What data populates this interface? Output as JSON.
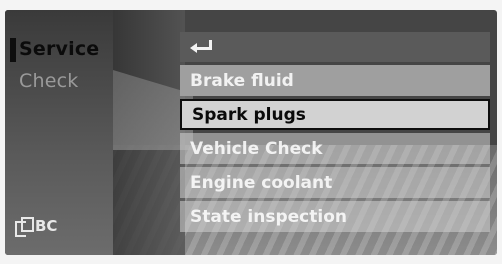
{
  "sidebar": {
    "items": [
      {
        "label": "Service",
        "selected": true
      },
      {
        "label": "Check",
        "selected": false
      }
    ],
    "footer_label": "BC",
    "footer_icon": "onboard-computer-icon"
  },
  "menu": {
    "back_icon": "return-arrow-icon",
    "items": [
      {
        "label": "Brake fluid"
      },
      {
        "label": "Spark plugs",
        "selected": true
      },
      {
        "label": "Vehicle Check"
      },
      {
        "label": "Engine coolant"
      },
      {
        "label": "State inspection"
      }
    ]
  },
  "colors": {
    "selection_border": "#0d0d0d",
    "selected_row": "#d2d2d2",
    "screen_background": "#454545"
  }
}
